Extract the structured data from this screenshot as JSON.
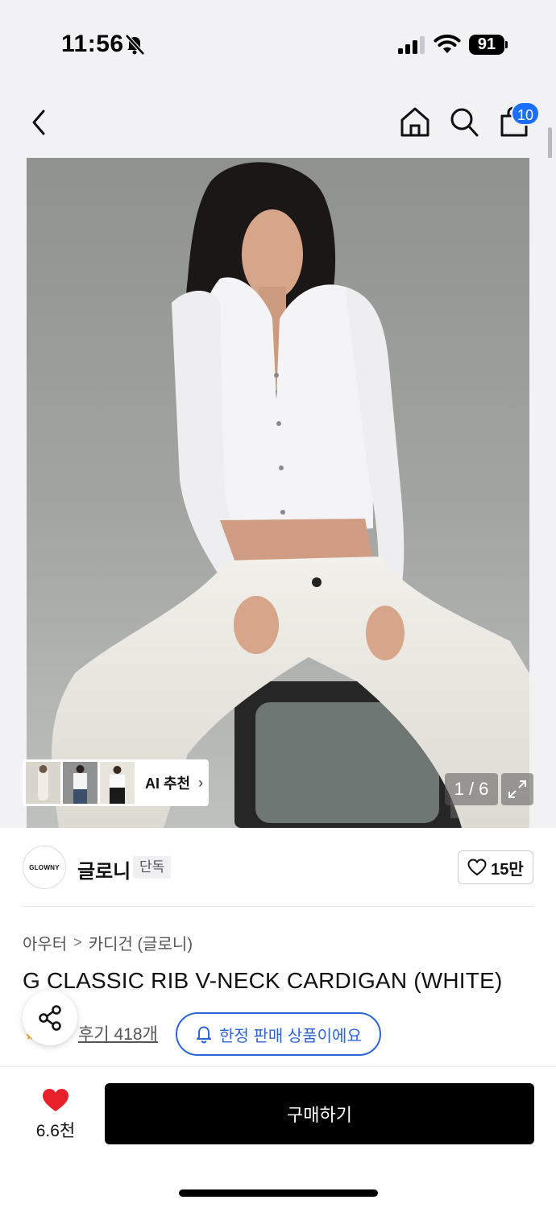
{
  "status_bar": {
    "time": "11:56",
    "battery": "91",
    "bell_icon": "bell-slash-icon",
    "signal_icon": "cellular-signal-icon",
    "wifi_icon": "wifi-icon"
  },
  "nav": {
    "back_icon": "chevron-left-icon",
    "home_icon": "home-icon",
    "search_icon": "search-icon",
    "cart_icon": "shopping-bag-icon",
    "cart_count": "10"
  },
  "gallery": {
    "page_counter": "1 / 6",
    "ai_label": "AI 추천",
    "ai_chevron": "›",
    "expand_icon": "expand-icon"
  },
  "brand": {
    "logo_text": "GLOWNY",
    "name": "글로니",
    "badge": "단독",
    "like_count": "15만"
  },
  "product": {
    "breadcrumb": [
      "아우터",
      "카디건 (글로니)"
    ],
    "breadcrumb_sep": ">",
    "title": "G CLASSIC RIB V-NECK CARDIGAN (WHITE)",
    "review_link": "후기 418개",
    "limited_notice": "한정 판매 상품이에요"
  },
  "bottom_bar": {
    "wish_count": "6.6천",
    "buy_label": "구매하기"
  },
  "colors": {
    "accent_blue": "#2d65d8",
    "badge_blue": "#1a6fff",
    "heart_red": "#e8202a",
    "buy_black": "#000000"
  }
}
